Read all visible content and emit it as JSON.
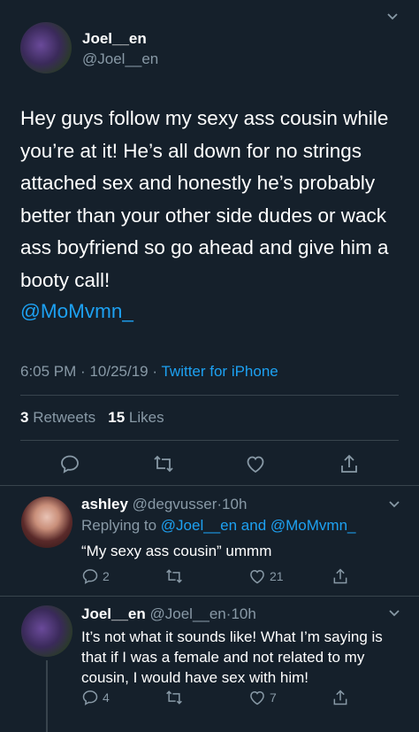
{
  "tweet": {
    "display_name": "Joel__en",
    "handle": "@Joel__en",
    "text": "Hey guys follow my sexy ass cousin while you’re at it! He’s all down for no strings attached sex and honestly he’s probably better than your other side dudes or wack ass boyfriend so go ahead and give him a booty call!",
    "mention": "@MoMvmn_",
    "time": "6:05 PM",
    "date": "10/25/19",
    "source": "Twitter for iPhone",
    "retweets": "3",
    "retweets_label": "Retweets",
    "likes": "15",
    "likes_label": "Likes"
  },
  "replies": [
    {
      "display_name": "ashley",
      "handle": "@degvusser",
      "age": "10h",
      "replying_to_prefix": "Replying to",
      "replying_to": "@Joel__en and @MoMvmn_",
      "text": "“My sexy ass cousin” ummm",
      "reply_count": "2",
      "retweet_count": "",
      "like_count": "21"
    },
    {
      "display_name": "Joel__en",
      "handle": "@Joel__en",
      "age": "10h",
      "text": "It’s not what it sounds like! What I’m saying is that if I was a female and not related to my cousin, I would have sex with him!",
      "reply_count": "4",
      "retweet_count": "",
      "like_count": "7"
    }
  ],
  "separator": "·",
  "icons": {
    "reply": "reply-icon",
    "retweet": "retweet-icon",
    "like": "like-icon",
    "share": "share-icon",
    "caret": "chevron-down-icon"
  },
  "colors": {
    "background": "#15202b",
    "accent": "#1da1f2",
    "muted": "#8899a6",
    "divider": "#38444d"
  }
}
